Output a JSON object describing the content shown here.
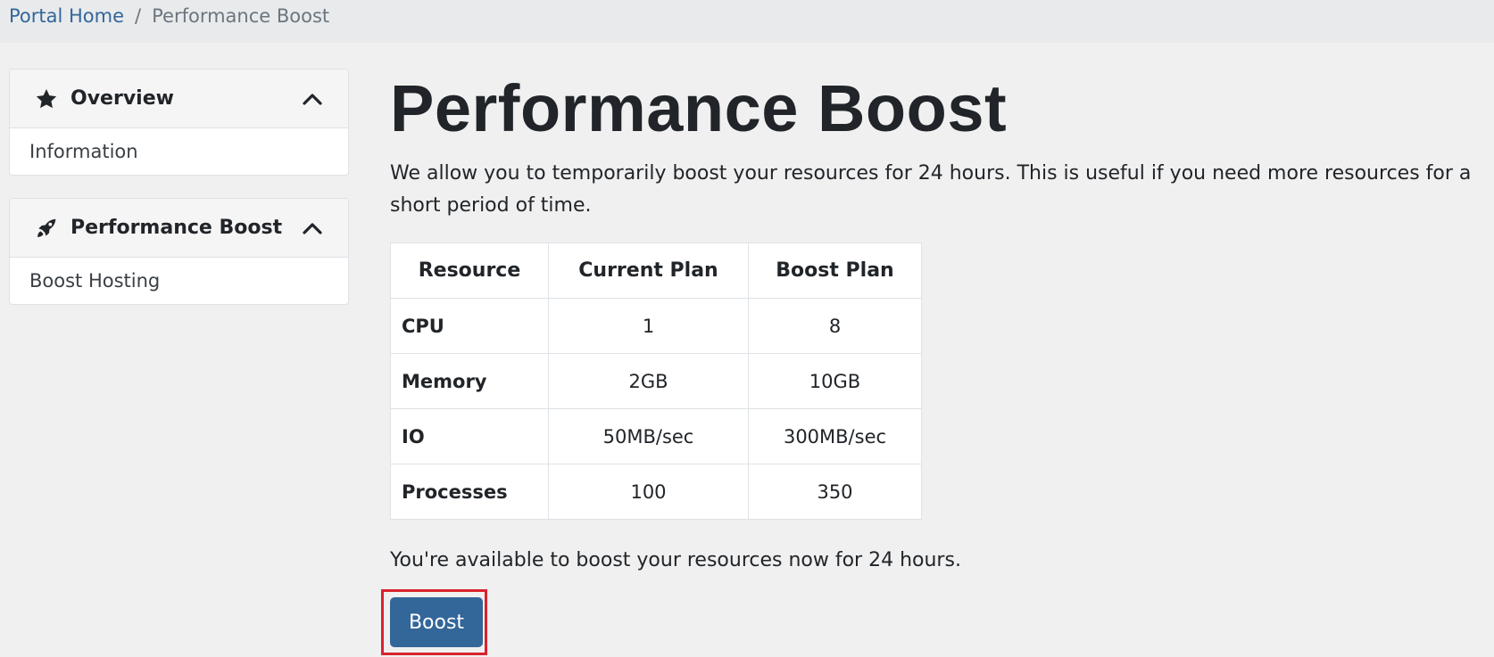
{
  "breadcrumb": {
    "home": "Portal Home",
    "separator": "/",
    "current": "Performance Boost"
  },
  "sidebar": {
    "panels": [
      {
        "title": "Overview",
        "icon": "star-icon",
        "items": [
          {
            "label": "Information"
          }
        ]
      },
      {
        "title": "Performance Boost",
        "icon": "rocket-icon",
        "items": [
          {
            "label": "Boost Hosting"
          }
        ]
      }
    ]
  },
  "main": {
    "title": "Performance Boost",
    "lead": "We allow you to temporarily boost your resources for 24 hours. This is useful if you need more resources for a short period of time.",
    "table": {
      "headers": [
        "Resource",
        "Current Plan",
        "Boost Plan"
      ],
      "rows": [
        [
          "CPU",
          "1",
          "8"
        ],
        [
          "Memory",
          "2GB",
          "10GB"
        ],
        [
          "IO",
          "50MB/sec",
          "300MB/sec"
        ],
        [
          "Processes",
          "100",
          "350"
        ]
      ]
    },
    "status": "You're available to boost your resources now for 24 hours.",
    "boost_label": "Boost"
  },
  "colors": {
    "accent": "#336699",
    "highlight": "#d9232e"
  }
}
